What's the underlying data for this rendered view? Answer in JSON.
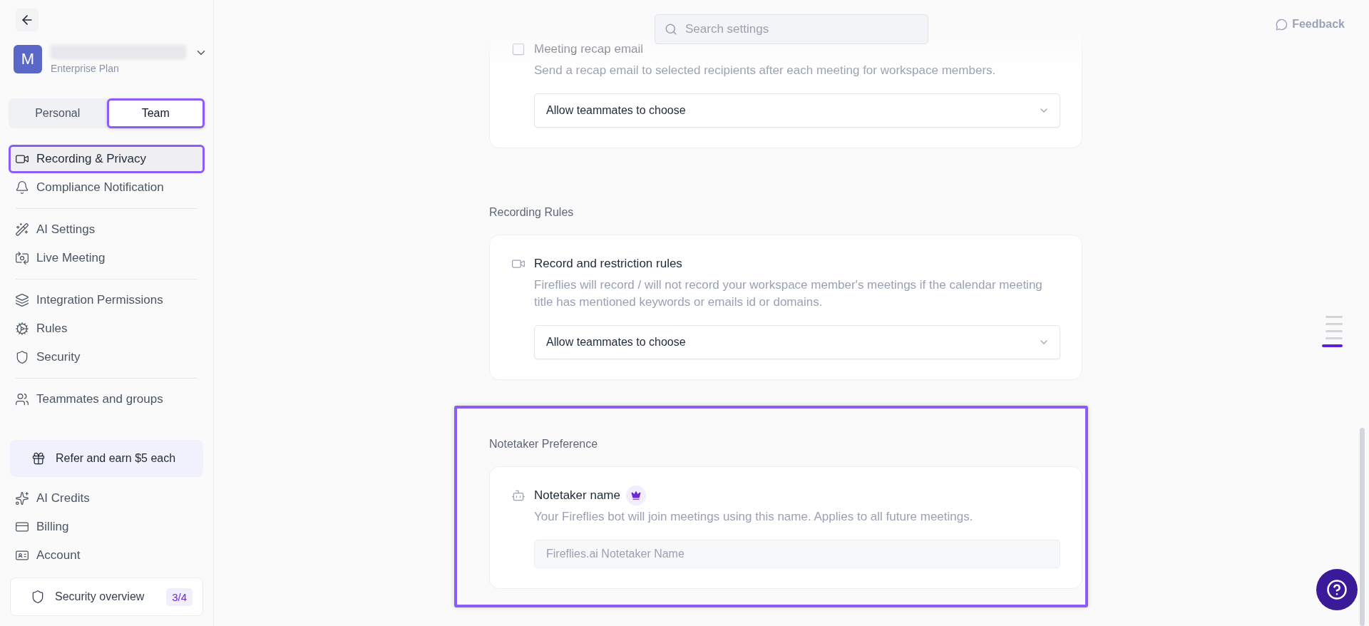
{
  "sidebar": {
    "account": {
      "avatar": "M",
      "plan": "Enterprise Plan"
    },
    "tabs": [
      {
        "label": "Personal",
        "selected": false,
        "highlighted": false
      },
      {
        "label": "Team",
        "selected": true,
        "highlighted": true
      }
    ],
    "nav_groups": [
      [
        {
          "label": "Recording & Privacy",
          "selected": true,
          "highlighted": true
        },
        {
          "label": "Compliance Notification",
          "selected": false,
          "highlighted": false
        }
      ],
      [
        {
          "label": "AI Settings",
          "selected": false,
          "highlighted": false
        },
        {
          "label": "Live Meeting",
          "selected": false,
          "highlighted": false
        }
      ],
      [
        {
          "label": "Integration Permissions",
          "selected": false,
          "highlighted": false
        },
        {
          "label": "Rules",
          "selected": false,
          "highlighted": false
        },
        {
          "label": "Security",
          "selected": false,
          "highlighted": false
        }
      ],
      [
        {
          "label": "Teammates and groups",
          "selected": false,
          "highlighted": false
        }
      ]
    ],
    "promo": {
      "label": "Refer and earn $5 each"
    },
    "bottom_items": [
      {
        "label": "AI Credits"
      },
      {
        "label": "Billing"
      },
      {
        "label": "Account"
      }
    ],
    "security_overview": {
      "label": "Security overview",
      "count": "3/4"
    }
  },
  "search": {
    "placeholder": "Search settings"
  },
  "feedback": {
    "label": "Feedback"
  },
  "sections": [
    {
      "highlighted": false,
      "card": {
        "title": "Meeting recap email",
        "premium": false,
        "description": "Send a recap email to selected recipients after each meeting for workspace members.",
        "control": {
          "kind": "select",
          "value": "Allow teammates to choose"
        }
      }
    },
    {
      "heading": "Recording Rules",
      "highlighted": false,
      "card": {
        "title": "Record and restriction rules",
        "premium": false,
        "description": "Fireflies will record / will not record your workspace member's meetings if the calendar meeting title has mentioned keywords or emails id or domains.",
        "control": {
          "kind": "select",
          "value": "Allow teammates to choose"
        }
      }
    },
    {
      "heading": "Notetaker Preference",
      "highlighted": true,
      "card": {
        "title": "Notetaker name",
        "premium": true,
        "description": "Your Fireflies bot will join meetings using this name. Applies to all future meetings.",
        "control": {
          "kind": "input",
          "placeholder": "Fireflies.ai Notetaker Name"
        }
      }
    }
  ],
  "section_nav": [
    {
      "selected": false
    },
    {
      "selected": false
    },
    {
      "selected": false
    },
    {
      "selected": false
    },
    {
      "selected": true
    }
  ]
}
